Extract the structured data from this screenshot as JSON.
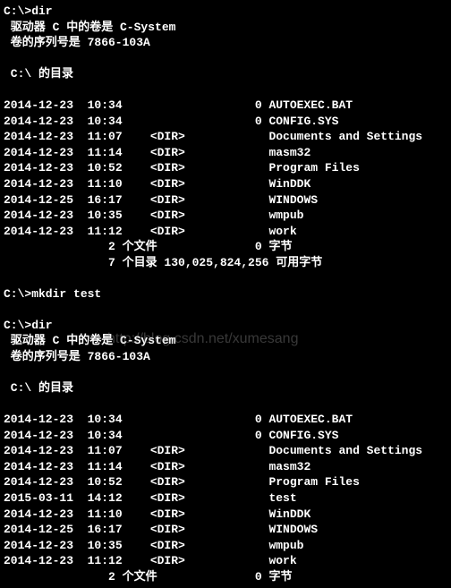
{
  "watermark": "http://blog.csdn.net/xumesang",
  "block1": {
    "prompt_line": "C:\\>dir",
    "vol_line": " 驱动器 C 中的卷是 C-System",
    "serial_line": " 卷的序列号是 7866-103A",
    "dir_of_line": " C:\\ 的目录",
    "rows": [
      "2014-12-23  10:34                   0 AUTOEXEC.BAT",
      "2014-12-23  10:34                   0 CONFIG.SYS",
      "2014-12-23  11:07    <DIR>            Documents and Settings",
      "2014-12-23  11:14    <DIR>            masm32",
      "2014-12-23  10:52    <DIR>            Program Files",
      "2014-12-23  11:10    <DIR>            WinDDK",
      "2014-12-25  16:17    <DIR>            WINDOWS",
      "2014-12-23  10:35    <DIR>            wmpub",
      "2014-12-23  11:12    <DIR>            work"
    ],
    "summary1": "               2 个文件              0 字节",
    "summary2": "               7 个目录 130,025,824,256 可用字节"
  },
  "mkdir_line": "C:\\>mkdir test",
  "block2": {
    "prompt_line": "C:\\>dir",
    "vol_line": " 驱动器 C 中的卷是 C-System",
    "serial_line": " 卷的序列号是 7866-103A",
    "dir_of_line": " C:\\ 的目录",
    "rows": [
      "2014-12-23  10:34                   0 AUTOEXEC.BAT",
      "2014-12-23  10:34                   0 CONFIG.SYS",
      "2014-12-23  11:07    <DIR>            Documents and Settings",
      "2014-12-23  11:14    <DIR>            masm32",
      "2014-12-23  10:52    <DIR>            Program Files",
      "2015-03-11  14:12    <DIR>            test",
      "2014-12-23  11:10    <DIR>            WinDDK",
      "2014-12-25  16:17    <DIR>            WINDOWS",
      "2014-12-23  10:35    <DIR>            wmpub",
      "2014-12-23  11:12    <DIR>            work"
    ],
    "summary1": "               2 个文件              0 字节"
  }
}
